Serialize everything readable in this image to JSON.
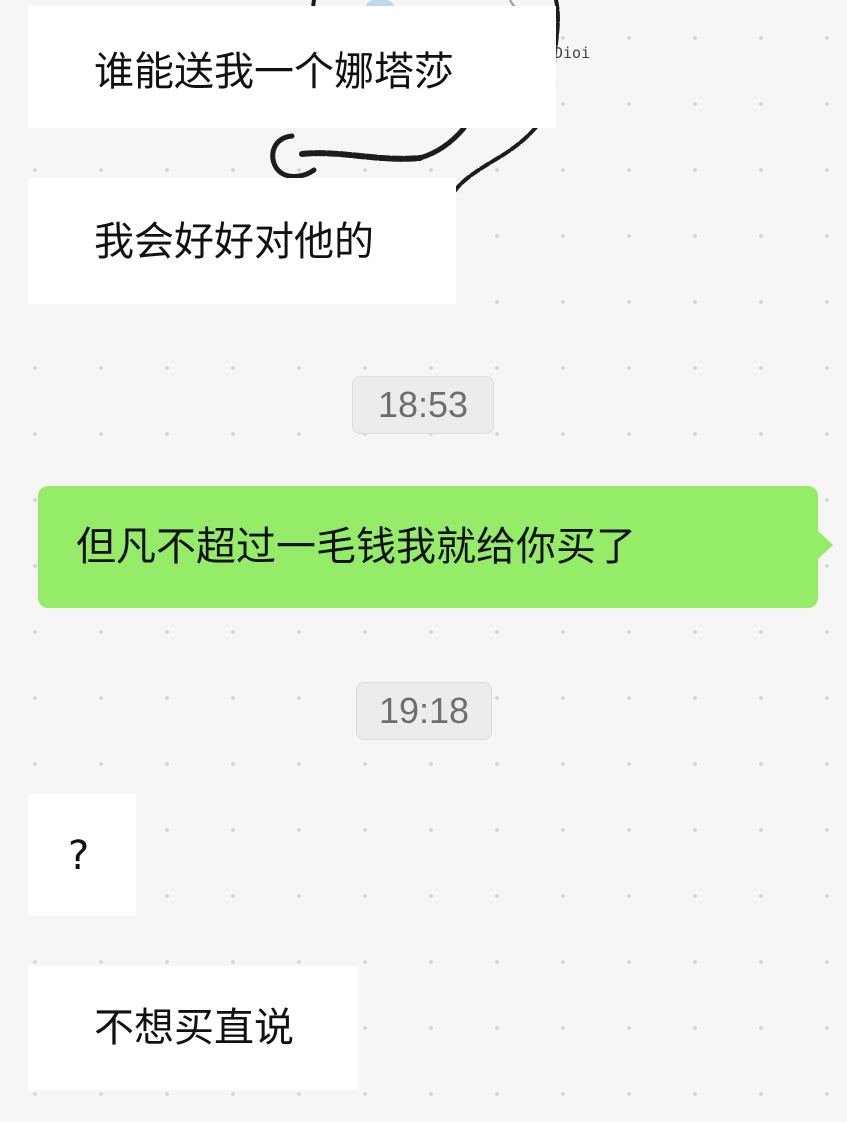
{
  "sticker": {
    "icon": "doodle-sticker-icon",
    "caption": "Dioi"
  },
  "messages": [
    {
      "direction": "in",
      "text": "谁能送我一个娜塔莎"
    },
    {
      "direction": "in",
      "text": "我会好好对他的"
    },
    {
      "direction": "out",
      "text": "但凡不超过一毛钱我就给你买了"
    },
    {
      "direction": "in",
      "text": "?"
    },
    {
      "direction": "in",
      "text": "不想买直说"
    }
  ],
  "timestamps": [
    "18:53",
    "19:18"
  ],
  "colors": {
    "background": "#f6f6f6",
    "incoming_bubble": "#ffffff",
    "outgoing_bubble": "#95ec69",
    "timestamp_bg": "#ececec",
    "timestamp_text": "#6e6e6e"
  }
}
